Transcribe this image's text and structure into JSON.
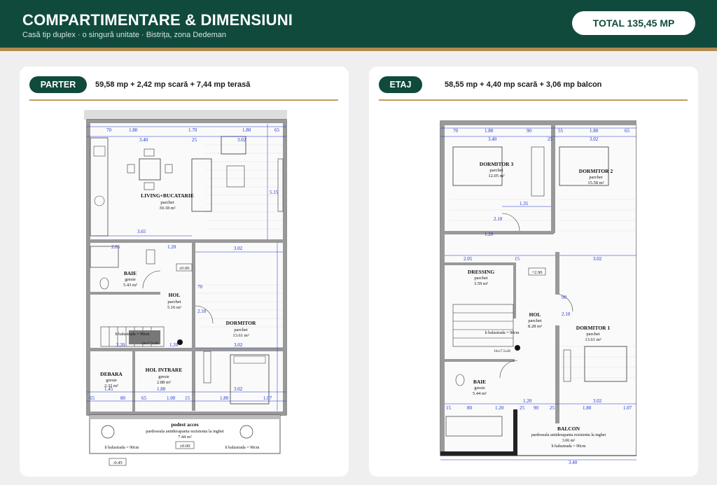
{
  "header": {
    "title": "COMPARTIMENTARE & DIMENSIUNI",
    "subtitle": "Casă tip duplex · o singură unitate · Bistrița, zona Dedeman",
    "total": "TOTAL 135,45 MP"
  },
  "colors": {
    "brand": "#0f4a3d",
    "accent": "#b08a4e",
    "dimension": "#1a2fd0"
  },
  "parter": {
    "label": "PARTER",
    "areas": "59,58 mp + 2,42 mp scară + 7,44 mp terasă",
    "rooms": {
      "living": {
        "name": "LIVING+BUCATARIE",
        "finish": "parchet",
        "area": "30.18 m²"
      },
      "baie": {
        "name": "BAIE",
        "finish": "gresie",
        "area": "5.43 m²"
      },
      "hol": {
        "name": "HOL",
        "finish": "parchet",
        "area": "5.16 m²"
      },
      "dormitor": {
        "name": "DORMITOR",
        "finish": "parchet",
        "area": "13.61 m²"
      },
      "debara": {
        "name": "DEBARA",
        "finish": "gresie",
        "area": "2.32 m²"
      },
      "hol_intrare": {
        "name": "HOL INTRARE",
        "finish": "gresie",
        "area": "2.88 m²"
      },
      "podest": {
        "name": "podest acces",
        "finish": "pardoseala antiderapanta rezistenta la inghet",
        "area": "7.44 m²"
      }
    },
    "levels": {
      "main": "±0.00",
      "podest": "±0.00",
      "exterior": "-0.45"
    },
    "notes": {
      "balustrada": "h balustrada = 90cm",
      "stair": "16x17.5x28"
    },
    "dims": {
      "top_row": [
        "70",
        "1.80",
        "1.70",
        "1.80",
        "65"
      ],
      "second_row": [
        "3.40",
        "25",
        "3.02"
      ],
      "mid": [
        "3.65",
        "2.05",
        "1.20",
        "3.02",
        "5.15"
      ],
      "low": [
        "1.20",
        "3.02",
        "2.20",
        "70",
        "2.10"
      ],
      "bottom_row": [
        "65",
        "1.45",
        "80",
        "65",
        "1.80",
        "1.00",
        "15",
        "1.80",
        "1.07"
      ],
      "bottom_total": "3.02"
    }
  },
  "etaj": {
    "label": "ETAJ",
    "areas": "58,55 mp + 4,40 mp scară + 3,06 mp balcon",
    "rooms": {
      "dormitor3": {
        "name": "DORMITOR 3",
        "finish": "parchet",
        "area": "12.05 m²"
      },
      "dormitor2": {
        "name": "DORMITOR 2",
        "finish": "parchet",
        "area": "15.58 m²"
      },
      "dressing": {
        "name": "DRESSING",
        "finish": "parchet",
        "area": "3.59 m²"
      },
      "hol": {
        "name": "HOL",
        "finish": "parchet",
        "area": "8.28 m²"
      },
      "dormitor1": {
        "name": "DORMITOR 1",
        "finish": "parchet",
        "area": "13.61 m²"
      },
      "baie": {
        "name": "BAIE",
        "finish": "gresie",
        "area": "5.44 m²"
      },
      "balcon": {
        "name": "BALCON",
        "finish": "pardoseala antiderapanta rezistenta la inghet",
        "area": "3.06 m²"
      }
    },
    "levels": {
      "main": "+2.90"
    },
    "notes": {
      "balustrada": "h balustrada = 90cm",
      "stair": "16x17.5x28"
    },
    "dims": {
      "top_row": [
        "70",
        "1.80",
        "90",
        "55",
        "1.80",
        "65"
      ],
      "second_row": [
        "3.40",
        "25",
        "3.02"
      ],
      "mid": [
        "1.35",
        "1.20",
        "2.10",
        "2.05",
        "15",
        "3.02"
      ],
      "low": [
        "1.20",
        "3.02",
        "90",
        "2.10"
      ],
      "bottom_row": [
        "15",
        "80",
        "1.20",
        "25",
        "90",
        "25",
        "1.80",
        "1.07"
      ],
      "bottom_total": "3.40"
    }
  }
}
